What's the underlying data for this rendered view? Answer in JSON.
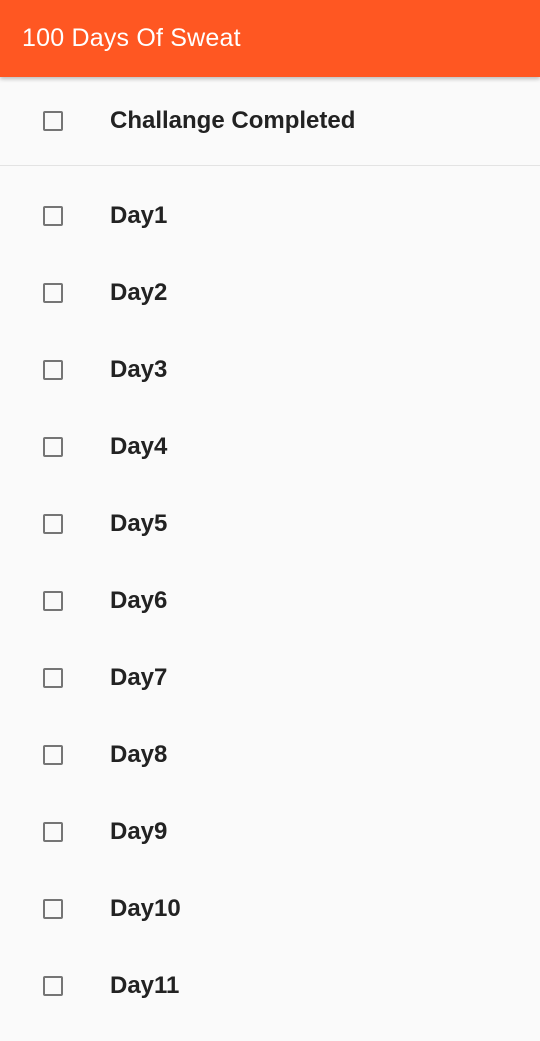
{
  "app_bar": {
    "title": "100 Days Of Sweat",
    "color": "#ff5722"
  },
  "challenge": {
    "label": "Challange Completed",
    "checked": false
  },
  "days": [
    {
      "label": "Day1",
      "checked": false
    },
    {
      "label": "Day2",
      "checked": false
    },
    {
      "label": "Day3",
      "checked": false
    },
    {
      "label": "Day4",
      "checked": false
    },
    {
      "label": "Day5",
      "checked": false
    },
    {
      "label": "Day6",
      "checked": false
    },
    {
      "label": "Day7",
      "checked": false
    },
    {
      "label": "Day8",
      "checked": false
    },
    {
      "label": "Day9",
      "checked": false
    },
    {
      "label": "Day10",
      "checked": false
    },
    {
      "label": "Day11",
      "checked": false
    }
  ]
}
